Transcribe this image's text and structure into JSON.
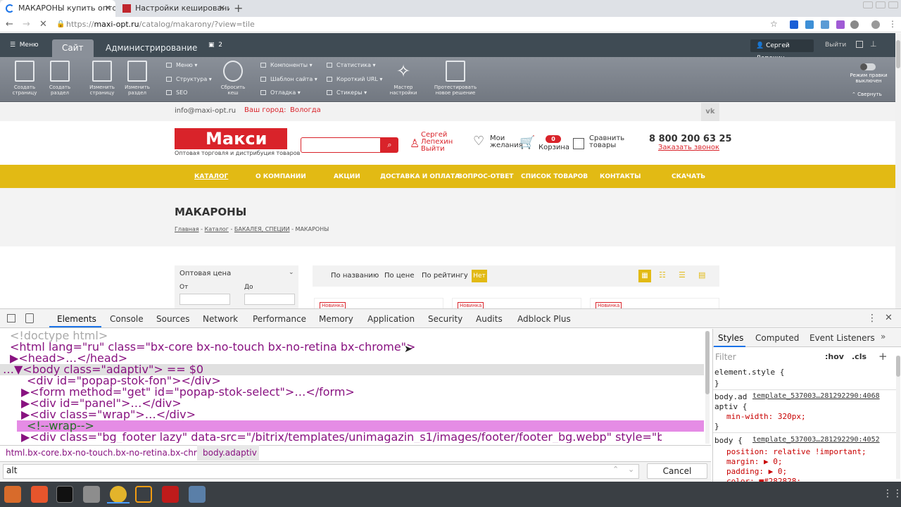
{
  "browser": {
    "tabs": [
      {
        "label": "МАКАРОНЫ купить опто",
        "active": true
      },
      {
        "label": "Настройки кеширования",
        "active": false
      }
    ],
    "url_scheme": "https://",
    "url_host": "maxi-opt.ru",
    "url_path": "/catalog/makarony/?view=tile"
  },
  "bx_panel": {
    "menu_label": "Меню",
    "tab_site": "Сайт",
    "tab_admin": "Администрирование",
    "notif_count": "2",
    "user": "Сергей Лепехин",
    "logout": "Выйти",
    "big_buttons": [
      {
        "label": "Создать страницу"
      },
      {
        "label": "Создать раздел"
      },
      {
        "label": "Изменить страницу"
      },
      {
        "label": "Изменить раздел"
      }
    ],
    "col1": [
      "Меню",
      "Структура",
      "SEO"
    ],
    "reset_cache": "Сбросить кеш",
    "col2": [
      "Компоненты",
      "Шаблон сайта",
      "Отладка"
    ],
    "col3": [
      "Статистика",
      "Короткий URL",
      "Стикеры"
    ],
    "wizard": "Мастер настройки",
    "test_solution": "Протестировать новое решение",
    "edit_mode": "Режим правки выключен",
    "collapse": "Свернуть"
  },
  "site": {
    "email": "info@maxi-opt.ru",
    "city_label": "Ваш город:",
    "city": "Вологда",
    "logo": "Макси",
    "tagline": "Оптовая торговля и дистрибуция товаров",
    "user_name": "Сергей Лепехин",
    "user_logout": "Выйти",
    "wishlist": "Мои желания",
    "cart_count": "0",
    "cart": "Корзина",
    "compare": "Сравнить товары",
    "phone": "8 800 200 63 25",
    "callback": "Заказать звонок",
    "menu": [
      "КАТАЛОГ",
      "О КОМПАНИИ",
      "АКЦИИ",
      "ДОСТАВКА И ОПЛАТА",
      "ВОПРОС-ОТВЕТ",
      "СПИСОК ТОВАРОВ",
      "КОНТАКТЫ",
      "СКАЧАТЬ"
    ],
    "page_title": "МАКАРОНЫ",
    "breadcrumbs": [
      "Главная",
      "Каталог",
      "БАКАЛЕЯ, СПЕЦИИ",
      "МАКАРОНЫ"
    ],
    "filter_title": "Оптовая цена",
    "filter_from": "От",
    "filter_to": "До",
    "sort": [
      "По названию",
      "По цене",
      "По рейтингу"
    ],
    "sort_badge": "Нет",
    "new_badge": "Новинка"
  },
  "devtools": {
    "tabs": [
      "Elements",
      "Console",
      "Sources",
      "Network",
      "Performance",
      "Memory",
      "Application",
      "Security",
      "Audits",
      "Adblock Plus"
    ],
    "dom": [
      "<!doctype html>",
      "<html lang=\"ru\" class=\"bx-core bx-no-touch bx-no-retina bx-chrome\">",
      "▶<head>…</head>",
      "…▼<body class=\"adaptiv\"> == $0",
      "<div id=\"popap-stok-fon\"></div>",
      "▶<form method=\"get\" id=\"popap-stok-select\">…</form>",
      "▶<div id=\"panel\">…</div>",
      "▶<div class=\"wrap\">…</div>",
      "<!--wrap-->",
      "▶<div class=\"bg_footer lazy\" data-src=\"/bitrix/templates/unimagazin_s1/images/footer/footer_bg.webp\" style=\"background-repeat:no-repeat ;"
    ],
    "crumbs": [
      "html.bx-core.bx-no-touch.bx-no-retina.bx-chrome",
      "body.adaptiv"
    ],
    "search_value": "alt",
    "cancel": "Cancel",
    "styles_tabs": [
      "Styles",
      "Computed",
      "Event Listeners"
    ],
    "filter_placeholder": "Filter",
    "hov": ":hov",
    "cls": ".cls",
    "rules": [
      {
        "selector": "element.style {",
        "source": "",
        "props": [],
        "close": "}"
      },
      {
        "selector": "body.ad aptiv {",
        "source": "template_537003…281292290:4068",
        "props": [
          "min-width: 320px;"
        ],
        "close": "}"
      },
      {
        "selector": "body {",
        "source": "template_537003…281292290:4052",
        "props": [
          "position: relative !important;",
          "margin: ▶ 0;",
          "padding: ▶ 0;",
          "color: ■#282828;"
        ],
        "close": ""
      }
    ]
  },
  "colors": {
    "accent_yellow": "#e2ba14",
    "logo_red": "#d9232a",
    "bx_dark": "#3f4b54"
  }
}
